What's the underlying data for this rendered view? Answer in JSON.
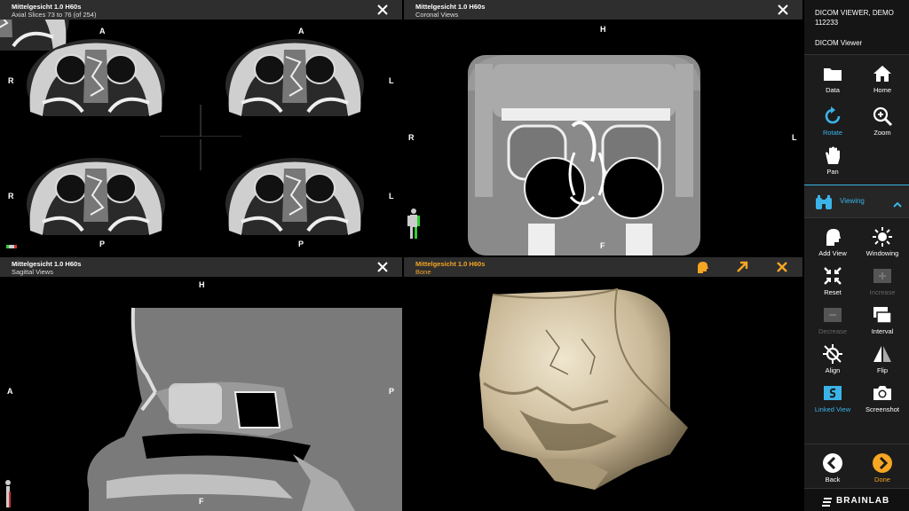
{
  "viewports": {
    "axial": {
      "title": "Mittelgesicht 1.0 H60s",
      "subtitle": "Axial Slices 73 to 76 (of 254)",
      "orient": {
        "top_a": "A",
        "top_b": "A",
        "left_a": "R",
        "left_b": "R",
        "right_a": "L",
        "right_b": "L",
        "bottom_a": "P",
        "bottom_b": "P"
      }
    },
    "coronal": {
      "title": "Mittelgesicht 1.0 H60s",
      "subtitle": "Coronal Views",
      "orient": {
        "top": "H",
        "left": "R",
        "right": "L",
        "bottom": "F"
      }
    },
    "sagittal": {
      "title": "Mittelgesicht 1.0 H60s",
      "subtitle": "Sagittal Views",
      "orient": {
        "top": "H",
        "left": "A",
        "right": "P",
        "bottom": "F"
      }
    },
    "volume": {
      "title": "Mittelgesicht 1.0 H60s",
      "subtitle": "Bone"
    }
  },
  "sidebar": {
    "app_title": "DICOM VIEWER, DEMO 112233",
    "subtitle": "DICOM Viewer",
    "tools": {
      "data": "Data",
      "home": "Home",
      "rotate": "Rotate",
      "zoom": "Zoom",
      "pan": "Pan",
      "add_view": "Add View",
      "windowing": "Windowing",
      "reset": "Reset",
      "increase": "Increase",
      "decrease": "Decrease",
      "interval": "Interval",
      "align": "Align",
      "flip": "Flip",
      "linked_view": "Linked View",
      "screenshot": "Screenshot",
      "back": "Back",
      "done": "Done"
    },
    "section_viewing": "Viewing",
    "brand": "BRAINLAB"
  },
  "colors": {
    "accent": "#3ab4e8",
    "orange": "#f5a623",
    "header": "#2e2e2e",
    "sidebar": "#1c1c1c"
  }
}
